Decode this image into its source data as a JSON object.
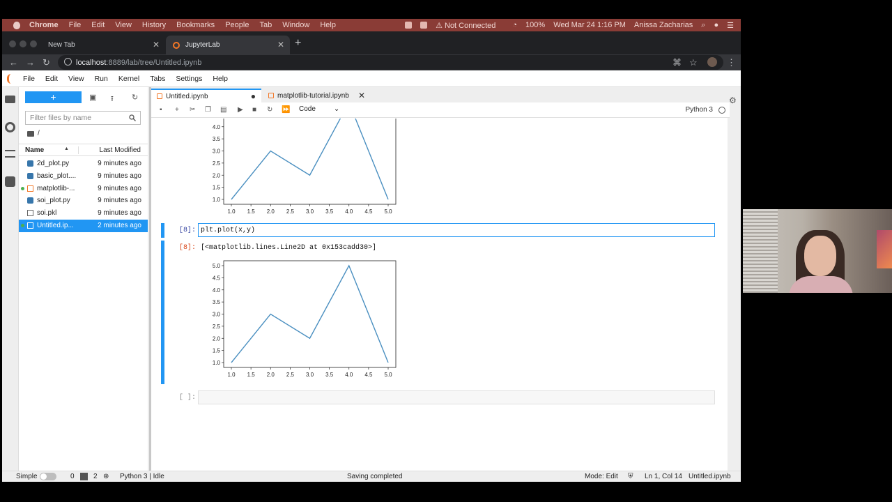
{
  "mac_menubar": {
    "app": "Chrome",
    "items": [
      "File",
      "Edit",
      "View",
      "History",
      "Bookmarks",
      "People",
      "Tab",
      "Window",
      "Help"
    ],
    "status": {
      "connection": "Not Connected",
      "battery": "100%",
      "datetime": "Wed Mar 24  1:16 PM",
      "user": "Anissa Zacharias"
    }
  },
  "browser": {
    "tabs": [
      {
        "title": "New Tab",
        "active": false
      },
      {
        "title": "JupyterLab",
        "active": true
      }
    ],
    "url_host": "localhost",
    "url_path": ":8889/lab/tree/Untitled.ipynb"
  },
  "jupyter": {
    "menu": [
      "File",
      "Edit",
      "View",
      "Run",
      "Kernel",
      "Tabs",
      "Settings",
      "Help"
    ],
    "filebrowser": {
      "new_button": "+",
      "filter_placeholder": "Filter files by name",
      "path": "/",
      "col_name": "Name",
      "col_modified": "Last Modified",
      "files": [
        {
          "name": "2d_plot.py",
          "modified": "9 minutes ago",
          "type": "python",
          "running": false,
          "selected": false
        },
        {
          "name": "basic_plot....",
          "modified": "9 minutes ago",
          "type": "python",
          "running": false,
          "selected": false
        },
        {
          "name": "matplotlib-...",
          "modified": "9 minutes ago",
          "type": "notebook",
          "running": true,
          "selected": false
        },
        {
          "name": "soi_plot.py",
          "modified": "9 minutes ago",
          "type": "python",
          "running": false,
          "selected": false
        },
        {
          "name": "soi.pkl",
          "modified": "9 minutes ago",
          "type": "file",
          "running": false,
          "selected": false
        },
        {
          "name": "Untitled.ip...",
          "modified": "2 minutes ago",
          "type": "notebook",
          "running": true,
          "selected": true
        }
      ]
    },
    "notebook_tabs": [
      {
        "title": "Untitled.ipynb",
        "active": true,
        "state": "●"
      },
      {
        "title": "matplotlib-tutorial.ipynb",
        "active": false,
        "state": "✕"
      }
    ],
    "toolbar": {
      "cell_type": "Code",
      "kernel": "Python 3"
    },
    "cells": {
      "input_prompt": "[8]:",
      "input_code": "plt.plot(x,y)",
      "output_prompt": "[8]:",
      "output_repr": "[<matplotlib.lines.Line2D at 0x153cadd30>]",
      "empty_prompt": "[ ]:"
    },
    "statusbar": {
      "mode_simple": "Simple",
      "terminals": "0",
      "kernels": "2",
      "kernel_status": "Python 3 | Idle",
      "message": "Saving completed",
      "mode": "Mode: Edit",
      "cursor": "Ln 1, Col 14",
      "filename": "Untitled.ipynb"
    }
  },
  "chart_data": [
    {
      "type": "line",
      "x": [
        1,
        2,
        3,
        4,
        5
      ],
      "y": [
        1,
        3,
        2,
        5,
        1
      ],
      "xlim": [
        1,
        5
      ],
      "ylim": [
        1,
        5
      ],
      "xticks": [
        "1.0",
        "1.5",
        "2.0",
        "2.5",
        "3.0",
        "3.5",
        "4.0",
        "4.5",
        "5.0"
      ],
      "yticks": [
        "1.0",
        "1.5",
        "2.0",
        "2.5",
        "3.0",
        "3.5",
        "4.0"
      ],
      "color": "#4a8fc0"
    },
    {
      "type": "line",
      "x": [
        1,
        2,
        3,
        4,
        5
      ],
      "y": [
        1,
        3,
        2,
        5,
        1
      ],
      "xlim": [
        1,
        5
      ],
      "ylim": [
        1,
        5
      ],
      "xticks": [
        "1.0",
        "1.5",
        "2.0",
        "2.5",
        "3.0",
        "3.5",
        "4.0",
        "4.5",
        "5.0"
      ],
      "yticks": [
        "1.0",
        "1.5",
        "2.0",
        "2.5",
        "3.0",
        "3.5",
        "4.0",
        "4.5",
        "5.0"
      ],
      "color": "#4a8fc0"
    }
  ]
}
